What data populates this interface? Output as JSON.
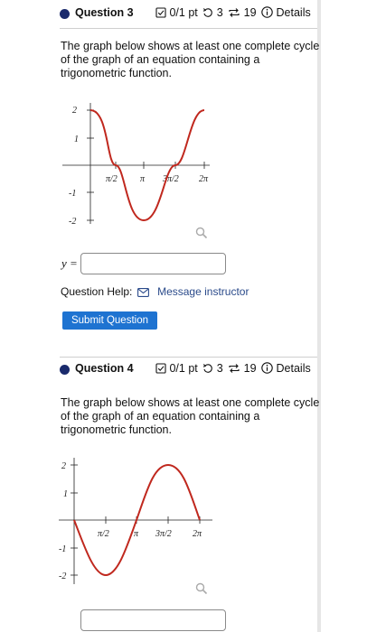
{
  "questions": [
    {
      "title": "Question 3",
      "points": "0/1 pt",
      "retries": "3",
      "submissions": "19",
      "details_label": "Details",
      "prompt": "The graph below shows at least one complete cycle of the graph of an equation containing a trigonometric function.",
      "answer_label": "y =",
      "answer_value": "",
      "graph": {
        "x_tick_labels": [
          "π/2",
          "π",
          "3π/2",
          "2π"
        ],
        "y_tick_labels": [
          "2",
          "1",
          "-1",
          "-2"
        ],
        "curve": "y = 2cos(x)",
        "domain": [
          0,
          6.28
        ],
        "range": [
          -2,
          2
        ]
      }
    },
    {
      "title": "Question 4",
      "points": "0/1 pt",
      "retries": "3",
      "submissions": "19",
      "details_label": "Details",
      "prompt": "The graph below shows at least one complete cycle of the graph of an equation containing a trigonometric function.",
      "answer_value": "",
      "graph": {
        "x_tick_labels": [
          "π/2",
          "π",
          "3π/2",
          "2π"
        ],
        "y_tick_labels": [
          "2",
          "1",
          "-1",
          "-2"
        ],
        "curve": "y = -2sin(x)",
        "domain": [
          0,
          6.28
        ],
        "range": [
          -2,
          2
        ]
      }
    }
  ],
  "help": {
    "label": "Question Help:",
    "message_link": "Message instructor"
  },
  "submit_label": "Submit Question",
  "colors": {
    "curve": "#c0281e",
    "accent": "#1e73d1",
    "dot": "#1a2a6c"
  },
  "icons": [
    "checkbox-icon",
    "retry-icon",
    "submissions-icon",
    "info-icon",
    "magnifier-icon",
    "envelope-icon"
  ]
}
